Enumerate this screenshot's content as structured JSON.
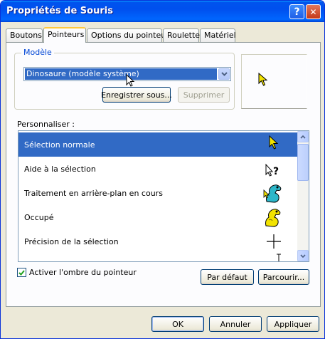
{
  "window": {
    "title": "Propriétés de Souris",
    "help_label": "?",
    "close_label": "✕"
  },
  "tabs": [
    {
      "label": "Boutons"
    },
    {
      "label": "Pointeurs"
    },
    {
      "label": "Options du pointeur"
    },
    {
      "label": "Roulette"
    },
    {
      "label": "Matériel"
    }
  ],
  "active_tab": "Pointeurs",
  "scheme": {
    "group_label": "Modèle",
    "selected_value": "Dinosaure (modèle système)",
    "save_as_label": "Enregistrer sous...",
    "delete_label": "Supprimer"
  },
  "customize": {
    "label": "Personnaliser :",
    "items": [
      {
        "label": "Sélection normale",
        "icon": "arrow-cursor-icon",
        "selected": true
      },
      {
        "label": "Aide à la sélection",
        "icon": "help-cursor-icon",
        "selected": false
      },
      {
        "label": "Traitement en arrière-plan en cours",
        "icon": "dinosaur-busy-icon",
        "selected": false
      },
      {
        "label": "Occupé",
        "icon": "dinosaur-wait-icon",
        "selected": false
      },
      {
        "label": "Précision de la sélection",
        "icon": "crosshair-icon",
        "selected": false
      }
    ]
  },
  "shadow": {
    "label": "Activer l'ombre du pointeur",
    "checked": true
  },
  "buttons": {
    "default_label": "Par défaut",
    "browse_label": "Parcourir...",
    "ok_label": "OK",
    "cancel_label": "Annuler",
    "apply_label": "Appliquer"
  },
  "colors": {
    "accent": "#316ac5",
    "titlebar": "#0054e3",
    "cursor_yellow": "#f2e300"
  }
}
